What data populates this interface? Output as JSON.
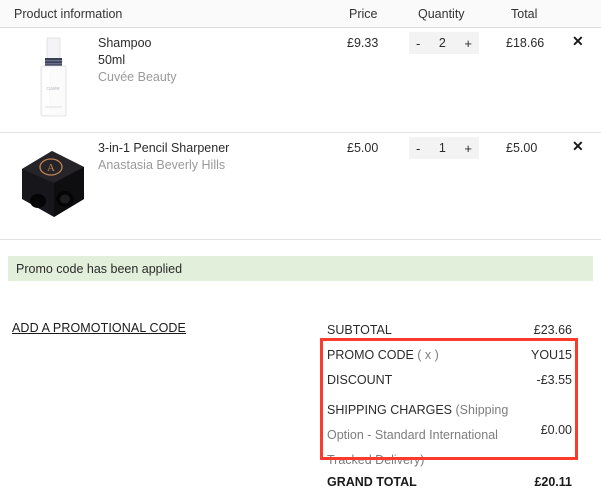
{
  "table_header": {
    "product_information": "Product information",
    "price": "Price",
    "quantity": "Quantity",
    "total": "Total"
  },
  "products": [
    {
      "name": "Shampoo",
      "variant": "50ml",
      "brand": "Cuvée Beauty",
      "price": "£9.33",
      "quantity": "2",
      "decrement_label": "-",
      "increment_label": "+",
      "total": "£18.66",
      "remove_label": "✕",
      "thumbnail_icon": "white-pump-bottle-image"
    },
    {
      "name": "3-in-1 Pencil Sharpener",
      "variant": "",
      "brand": "Anastasia Beverly Hills",
      "price": "£5.00",
      "quantity": "1",
      "decrement_label": "-",
      "increment_label": "+",
      "total": "£5.00",
      "remove_label": "✕",
      "thumbnail_icon": "black-pencil-sharpener-image"
    }
  ],
  "promo_banner": {
    "message": "Promo code has been applied",
    "background_color": "#e2efda"
  },
  "promo_link": {
    "label": "ADD A PROMOTIONAL CODE"
  },
  "summary": {
    "subtotal_label": "SUBTOTAL",
    "subtotal_value": "£23.66",
    "promo_code_label": "PROMO CODE",
    "promo_code_remove": "( x )",
    "promo_code_value": "YOU15",
    "discount_label": "DISCOUNT",
    "discount_value": "-£3.55",
    "shipping_label": "SHIPPING CHARGES ",
    "shipping_detail": "(Shipping Option - Standard International Tracked Delivery)",
    "shipping_value": "£0.00",
    "grand_total_label": "GRAND TOTAL",
    "grand_total_value": "£20.11"
  },
  "highlight": {
    "color": "#fc3b2d"
  }
}
